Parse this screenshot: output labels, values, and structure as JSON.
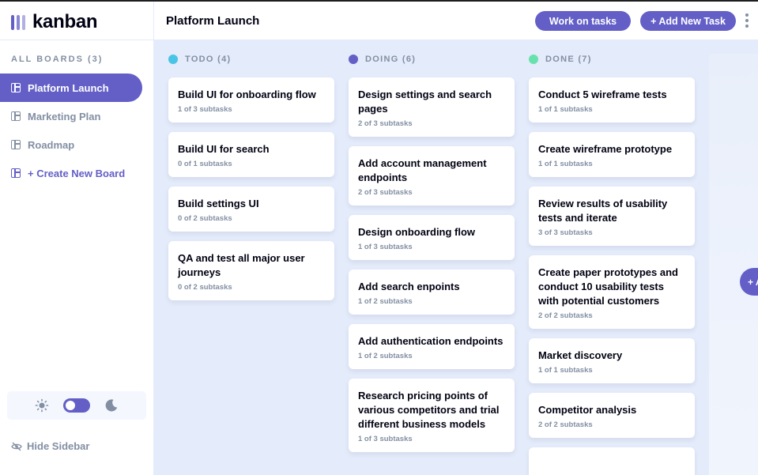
{
  "app": {
    "name": "kanban"
  },
  "sidebar": {
    "boards_title": "ALL BOARDS (3)",
    "boards": [
      {
        "label": "Platform Launch",
        "active": true
      },
      {
        "label": "Marketing Plan",
        "active": false
      },
      {
        "label": "Roadmap",
        "active": false
      }
    ],
    "create_label": "+ Create New Board",
    "theme": {
      "light_icon": "sun-icon",
      "dark_icon": "moon-icon",
      "dark_mode": false
    },
    "hide_label": "Hide Sidebar"
  },
  "header": {
    "board_title": "Platform Launch",
    "work_button": "Work on tasks",
    "add_button": "+ Add New Task",
    "more_icon": "vertical-ellipsis-icon"
  },
  "columns": [
    {
      "title": "TODO (4)",
      "color": "#49c4e5",
      "tasks": [
        {
          "title": "Build UI for onboarding flow",
          "subtasks": "1 of 3 subtasks"
        },
        {
          "title": "Build UI for search",
          "subtasks": "0 of 1 subtasks"
        },
        {
          "title": "Build settings UI",
          "subtasks": "0 of 2 subtasks"
        },
        {
          "title": "QA and test all major user journeys",
          "subtasks": "0 of 2 subtasks"
        }
      ]
    },
    {
      "title": "DOING (6)",
      "color": "#635fc7",
      "tasks": [
        {
          "title": "Design settings and search pages",
          "subtasks": "2 of 3 subtasks"
        },
        {
          "title": "Add account management endpoints",
          "subtasks": "2 of 3 subtasks"
        },
        {
          "title": "Design onboarding flow",
          "subtasks": "1 of 3 subtasks"
        },
        {
          "title": "Add search enpoints",
          "subtasks": "1 of 2 subtasks"
        },
        {
          "title": "Add authentication endpoints",
          "subtasks": "1 of 2 subtasks"
        },
        {
          "title": "Research pricing points of various competitors and trial different business models",
          "subtasks": "1 of 3 subtasks"
        }
      ]
    },
    {
      "title": "DONE (7)",
      "color": "#67e2ae",
      "tasks": [
        {
          "title": "Conduct 5 wireframe tests",
          "subtasks": "1 of 1 subtasks"
        },
        {
          "title": "Create wireframe prototype",
          "subtasks": "1 of 1 subtasks"
        },
        {
          "title": "Review results of usability tests and iterate",
          "subtasks": "3 of 3 subtasks"
        },
        {
          "title": "Create paper prototypes and conduct 10 usability tests with potential customers",
          "subtasks": "2 of 2 subtasks"
        },
        {
          "title": "Market discovery",
          "subtasks": "1 of 1 subtasks"
        },
        {
          "title": "Competitor analysis",
          "subtasks": "2 of 2 subtasks"
        },
        {
          "title": "",
          "subtasks": ""
        }
      ]
    }
  ],
  "floating_add": "+ Add New Column"
}
